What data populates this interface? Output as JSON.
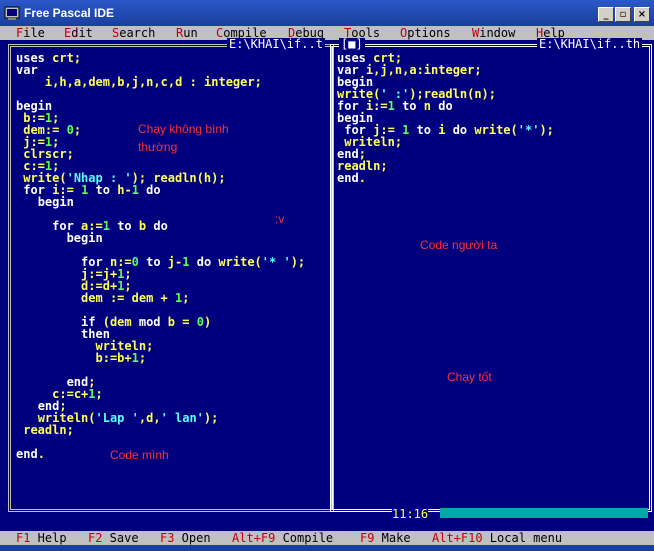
{
  "window": {
    "title": "Free Pascal IDE"
  },
  "menu": [
    "File",
    "Edit",
    "Search",
    "Run",
    "Compile",
    "Debug",
    "Tools",
    "Options",
    "Window",
    "Help"
  ],
  "left_pane": {
    "title": "E:\\KHAI\\if..t",
    "lines": [
      "uses crt;",
      "var",
      "    i,h,a,dem,b,j,n,c,d : integer;",
      "",
      "begin",
      " b:=1;",
      " dem:= 0;",
      " j:=1;",
      " clrscr;",
      " c:=1;",
      " write('Nhap : '); readln(h);",
      " for i:= 1 to h-1 do",
      "   begin",
      "",
      "     for a:=1 to b do",
      "       begin",
      "",
      "         for n:=0 to j-1 do write('* ');",
      "         j:=j+1;",
      "         d:=d+1;",
      "         dem := dem + 1;",
      "",
      "         if (dem mod b = 0)",
      "         then",
      "           writeln;",
      "           b:=b+1;",
      "",
      "       end;",
      "     c:=c+1;",
      "   end;",
      "   writeln('Lap ',d,' lan');",
      " readln;",
      "",
      "end."
    ]
  },
  "right_pane": {
    "title": "E:\\KHAI\\if..th",
    "window_num": "[■]",
    "lines": [
      "uses crt;",
      "var i,j,n,a:integer;",
      "begin",
      "write(' :');readln(n);",
      "for i:=1 to n do",
      "begin",
      " for j:= 1 to i do write('*');",
      " writeln;",
      "end;",
      "readln;",
      "end."
    ],
    "cursor_pos": "11:16"
  },
  "notes": {
    "n1a": "Chạy không bình",
    "n1b": "thường",
    "n2": ":v",
    "n3": "Code người ta",
    "n4": "Chạy tốt",
    "n5": "Code mình"
  },
  "status": [
    {
      "key": "F1",
      "label": "Help"
    },
    {
      "key": "F2",
      "label": "Save"
    },
    {
      "key": "F3",
      "label": "Open"
    },
    {
      "key": "Alt+F9",
      "label": "Compile"
    },
    {
      "key": "F9",
      "label": "Make"
    },
    {
      "key": "Alt+F10",
      "label": "Local menu"
    }
  ]
}
